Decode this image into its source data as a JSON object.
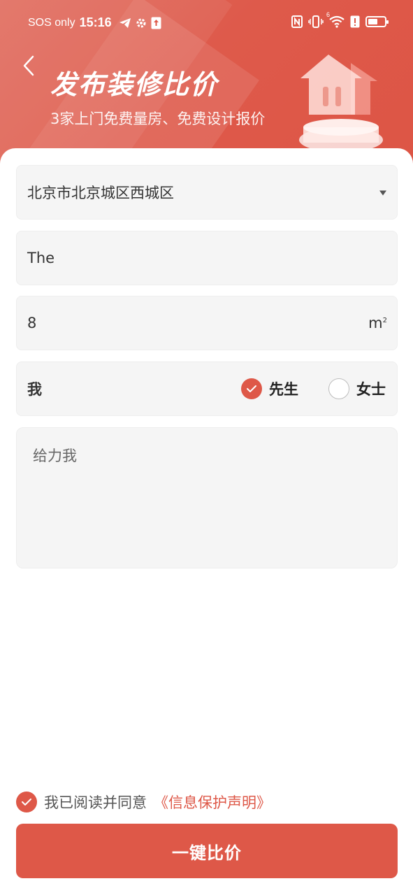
{
  "status_bar": {
    "carrier": "SOS only",
    "time": "15:16",
    "icons_left": [
      "telegram-icon",
      "gear-icon",
      "upload-icon"
    ],
    "icons_right": [
      "nfc-icon",
      "vibrate-icon",
      "wifi-icon",
      "alert-icon",
      "battery-icon"
    ],
    "wifi_badge": "6",
    "battery_level": 0.6
  },
  "header": {
    "title": "发布装修比价",
    "subtitle": "3家上门免费量房、免费设计报价",
    "accent_color": "#de5848"
  },
  "form": {
    "city": "北京市北京城区西城区",
    "community": "The",
    "area_value": "8",
    "area_unit": "m",
    "area_unit_sup": "2",
    "name_value": "我",
    "gender_options": [
      {
        "label": "先生",
        "selected": true
      },
      {
        "label": "女士",
        "selected": false
      }
    ],
    "remark": "给力我"
  },
  "agreement": {
    "text": "我已阅读并同意",
    "link": "《信息保护声明》",
    "checked": true
  },
  "submit_label": "一键比价"
}
